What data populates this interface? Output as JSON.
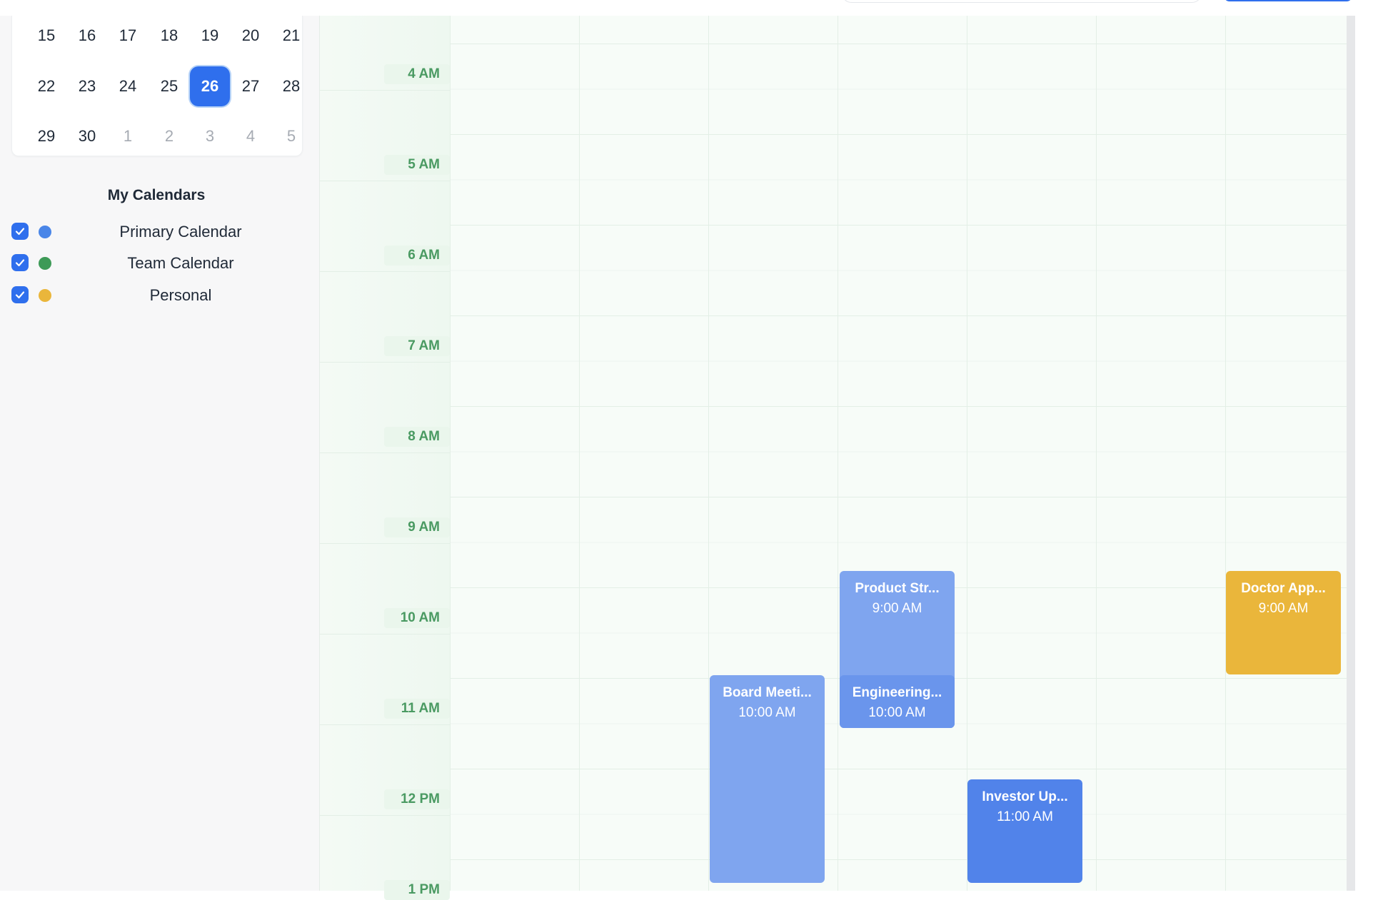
{
  "mini_calendar": {
    "weeks": [
      [
        {
          "d": "15"
        },
        {
          "d": "16"
        },
        {
          "d": "17"
        },
        {
          "d": "18"
        },
        {
          "d": "19"
        },
        {
          "d": "20"
        },
        {
          "d": "21"
        }
      ],
      [
        {
          "d": "22"
        },
        {
          "d": "23"
        },
        {
          "d": "24"
        },
        {
          "d": "25"
        },
        {
          "d": "26",
          "selected": true
        },
        {
          "d": "27"
        },
        {
          "d": "28"
        }
      ],
      [
        {
          "d": "29"
        },
        {
          "d": "30"
        },
        {
          "d": "1",
          "muted": true
        },
        {
          "d": "2",
          "muted": true
        },
        {
          "d": "3",
          "muted": true
        },
        {
          "d": "4",
          "muted": true
        },
        {
          "d": "5",
          "muted": true
        }
      ]
    ]
  },
  "my_calendars": {
    "title": "My Calendars",
    "items": [
      {
        "label": "Primary Calendar",
        "color": "#4a86e8",
        "checked": true
      },
      {
        "label": "Team Calendar",
        "color": "#3d9a57",
        "checked": true
      },
      {
        "label": "Personal",
        "color": "#eab63b",
        "checked": true
      }
    ]
  },
  "hours": [
    "4 AM",
    "5 AM",
    "6 AM",
    "7 AM",
    "8 AM",
    "9 AM",
    "10 AM",
    "11 AM",
    "12 PM",
    "1 PM"
  ],
  "events": [
    {
      "title": "Product Str...",
      "time": "9:00 AM",
      "color": "#7fa5ef"
    },
    {
      "title": "Doctor App...",
      "time": "9:00 AM",
      "color": "#eab63b"
    },
    {
      "title": "Board Meeti...",
      "time": "10:00 AM",
      "color": "#7fa5ef"
    },
    {
      "title": "Engineering...",
      "time": "10:00 AM",
      "color": "#6a95ec"
    },
    {
      "title": "Investor Up...",
      "time": "11:00 AM",
      "color": "#5183ea"
    }
  ],
  "colors": {
    "accent": "#2f6fed",
    "hour_label": "#4a9a62"
  }
}
